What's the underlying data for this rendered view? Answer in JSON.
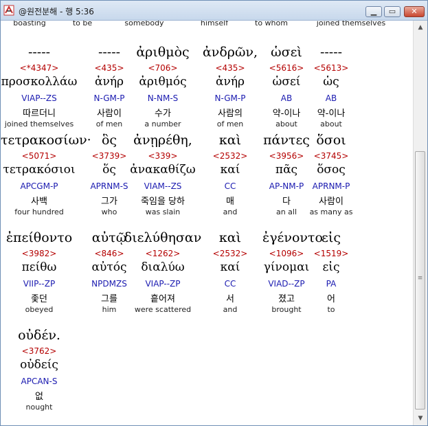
{
  "window": {
    "title": "@원전분해 - 행 5:36"
  },
  "top_glosses": [
    "boasting",
    "to be",
    "somebody",
    "himself",
    "to whom",
    "joined themselves"
  ],
  "rows": [
    {
      "words": [
        {
          "head": "-----",
          "strongs": "<*4347>",
          "lemma": "προσκολλάω",
          "parse": "VIAP--ZS",
          "korean": "따르더니",
          "english": "joined themselves"
        },
        {
          "head": "-----",
          "strongs": "<435>",
          "lemma": "ἀνήρ",
          "parse": "N-GM-P",
          "korean": "사람이",
          "english": "of men"
        },
        {
          "head": "ἀριθμὸς",
          "strongs": "<706>",
          "lemma": "ἀριθμός",
          "parse": "N-NM-S",
          "korean": "수가",
          "english": "a number"
        },
        {
          "head": "ἀνδρῶν,",
          "strongs": "<435>",
          "lemma": "ἀνήρ",
          "parse": "N-GM-P",
          "korean": "사람의",
          "english": "of men"
        },
        {
          "head": "ὡσεὶ",
          "strongs": "<5616>",
          "lemma": "ὡσεί",
          "parse": "AB",
          "korean": "약-이나",
          "english": "about"
        },
        {
          "head": "-----",
          "strongs": "<5613>",
          "lemma": "ὡς",
          "parse": "AB",
          "korean": "약-이나",
          "english": "about"
        }
      ]
    },
    {
      "words": [
        {
          "head": "τετρακοσίων·",
          "strongs": "<5071>",
          "lemma": "τετρακόσιοι",
          "parse": "APCGM-P",
          "korean": "사백",
          "english": "four hundred"
        },
        {
          "head": "ὃς",
          "strongs": "<3739>",
          "lemma": "ὅς",
          "parse": "APRNM-S",
          "korean": "그가",
          "english": "who"
        },
        {
          "head": "ἀνῃρέθη,",
          "strongs": "<339>",
          "lemma": "ἀνακαθίζω",
          "parse": "VIAM--ZS",
          "korean": "죽임을 당하",
          "english": "was slain"
        },
        {
          "head": "καὶ",
          "strongs": "<2532>",
          "lemma": "καί",
          "parse": "CC",
          "korean": "매",
          "english": "and"
        },
        {
          "head": "πάντες",
          "strongs": "<3956>",
          "lemma": "πᾶς",
          "parse": "AP-NM-P",
          "korean": "다",
          "english": "an all"
        },
        {
          "head": "ὅσοι",
          "strongs": "<3745>",
          "lemma": "ὅσος",
          "parse": "APRNM-P",
          "korean": "사람이",
          "english": "as many as"
        }
      ]
    },
    {
      "words": [
        {
          "head": "ἐπείθοντο",
          "strongs": "<3982>",
          "lemma": "πείθω",
          "parse": "VIIP--ZP",
          "korean": "좇던",
          "english": "obeyed"
        },
        {
          "head": "αὐτῷ",
          "strongs": "<846>",
          "lemma": "αὐτός",
          "parse": "NPDMZS",
          "korean": "그를",
          "english": "him"
        },
        {
          "head": "διελύθησαν",
          "strongs": "<1262>",
          "lemma": "διαλύω",
          "parse": "VIAP--ZP",
          "korean": "흩어져",
          "english": "were scattered"
        },
        {
          "head": "καὶ",
          "strongs": "<2532>",
          "lemma": "καί",
          "parse": "CC",
          "korean": "서",
          "english": "and"
        },
        {
          "head": "ἐγένοντο",
          "strongs": "<1096>",
          "lemma": "γίνομαι",
          "parse": "VIAD--ZP",
          "korean": "졌고",
          "english": "brought"
        },
        {
          "head": "εἰς",
          "strongs": "<1519>",
          "lemma": "εἰς",
          "parse": "PA",
          "korean": "어",
          "english": "to"
        }
      ]
    },
    {
      "words": [
        {
          "head": "οὐδέν.",
          "strongs": "<3762>",
          "lemma": "οὐδείς",
          "parse": "APCAN-S",
          "korean": "없",
          "english": "nought"
        }
      ]
    }
  ],
  "colors": {
    "strongs": "#b40000",
    "parse": "#1a1ab0",
    "titlebar": "#c7d8ec"
  },
  "icons": {
    "app": "logo-icon",
    "minimize": "minimize-icon",
    "maximize": "maximize-icon",
    "close": "close-icon"
  }
}
